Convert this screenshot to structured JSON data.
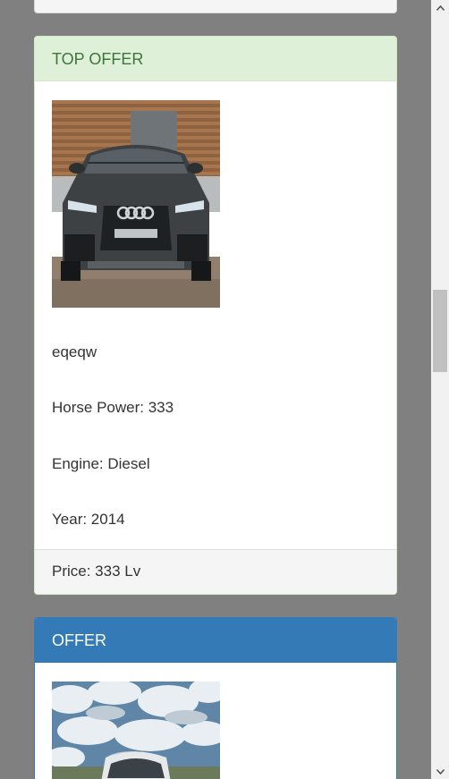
{
  "top_offer": {
    "heading": "TOP OFFER",
    "image": "car-front-photo",
    "name": "eqeqw",
    "horse_power": "Horse Power: 333",
    "engine": "Engine: Diesel",
    "year": "Year: 2014",
    "price": "Price: 333 Lv"
  },
  "offer": {
    "heading": "OFFER",
    "image": "car-sky-photo"
  },
  "colors": {
    "top_offer_heading_bg": "#dff0d8",
    "top_offer_heading_text": "#3c763d",
    "offer_heading_bg": "#337ab7",
    "page_bg": "#808080"
  }
}
